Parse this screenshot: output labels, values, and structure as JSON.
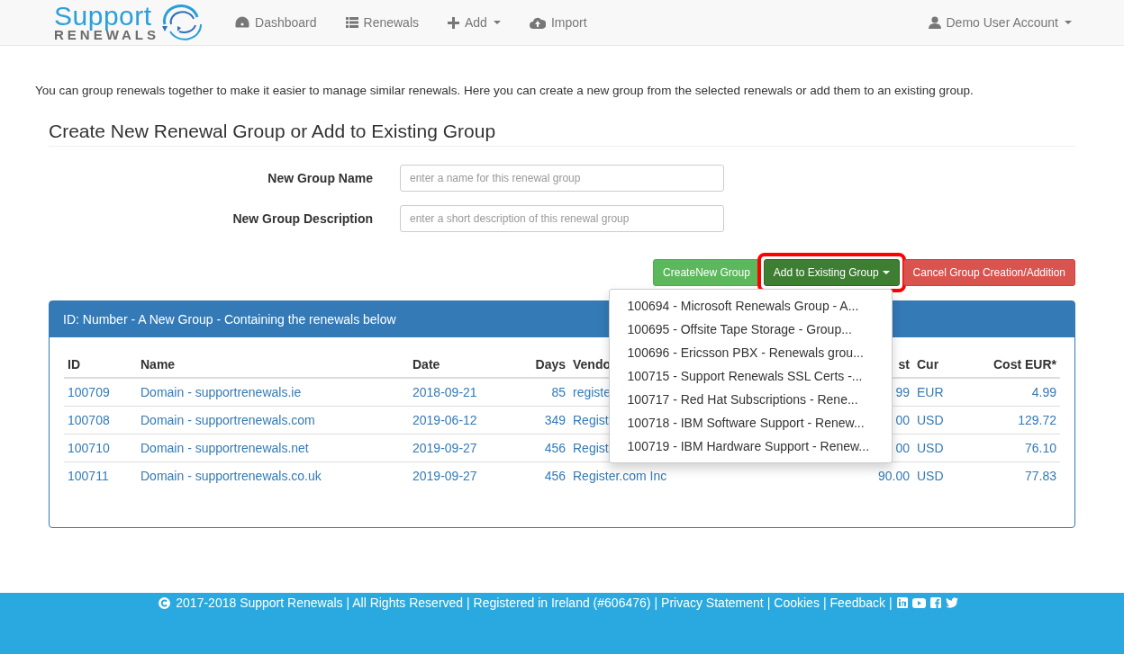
{
  "navbar": {
    "logo": {
      "top": "Support",
      "bottom": "RENEWALS"
    },
    "items": [
      {
        "kind": "dashboard",
        "label": "Dashboard",
        "caret": false
      },
      {
        "kind": "list",
        "label": "Renewals",
        "caret": false
      },
      {
        "kind": "plus",
        "label": "Add",
        "caret": true
      },
      {
        "kind": "upload",
        "label": "Import",
        "caret": false
      }
    ],
    "user": {
      "label": "Demo User Account",
      "caret": true
    }
  },
  "intro": "You can group renewals together to make it easier to manage similar renewals. Here you can create a new group from the selected renewals or add them to an existing group.",
  "heading": "Create New Renewal Group or Add to Existing Group",
  "fields": [
    {
      "label": "New Group Name",
      "placeholder": "enter a name for this renewal group"
    },
    {
      "label": "New Group Description",
      "placeholder": "enter a short description of this renewal group"
    }
  ],
  "buttons": [
    {
      "kind": "success",
      "label": "CreateNew Group",
      "caret": false,
      "highlighted": false
    },
    {
      "kind": "success-dark",
      "label": "Add to Existing Group",
      "caret": true,
      "highlighted": true
    },
    {
      "kind": "danger",
      "label": "Cancel Group Creation/Addition",
      "caret": false,
      "highlighted": false
    }
  ],
  "dropdown": {
    "items": [
      "100694 - Microsoft Renewals Group - A...",
      "100695 - Offsite Tape Storage - Group...",
      "100696 - Ericsson PBX - Renewals grou...",
      "100715 - Support Renewals SSL Certs -...",
      "100717 - Red Hat Subscriptions - Rene...",
      "100718 - IBM Software Support - Renew...",
      "100719 - IBM Hardware Support - Renew..."
    ]
  },
  "panel": {
    "title": "ID: Number - A New Group - Containing the renewals below",
    "table": {
      "columns": [
        "ID",
        "Name",
        "Date",
        "Days",
        "Vendo",
        "st",
        "Cur",
        "Cost EUR*"
      ],
      "rows": [
        [
          "100709",
          "Domain - supportrenewals.ie",
          "2018-09-21",
          "85",
          "registe",
          "99",
          "EUR",
          "4.99"
        ],
        [
          "100708",
          "Domain - supportrenewals.com",
          "2019-06-12",
          "349",
          "Regist",
          "00",
          "USD",
          "129.72"
        ],
        [
          "100710",
          "Domain - supportrenewals.net",
          "2019-09-27",
          "456",
          "Regist",
          "00",
          "USD",
          "76.10"
        ],
        [
          "100711",
          "Domain - supportrenewals.co.uk",
          "2019-09-27",
          "456",
          "Register.com Inc",
          "90.00",
          "USD",
          "77.83"
        ]
      ]
    }
  },
  "footer": {
    "notice": "2017-2018 Support Renewals | All Rights Reserved | Registered in Ireland (#606476)",
    "separator": "|",
    "links": [
      "Privacy Statement",
      "Cookies",
      "Feedback"
    ]
  }
}
